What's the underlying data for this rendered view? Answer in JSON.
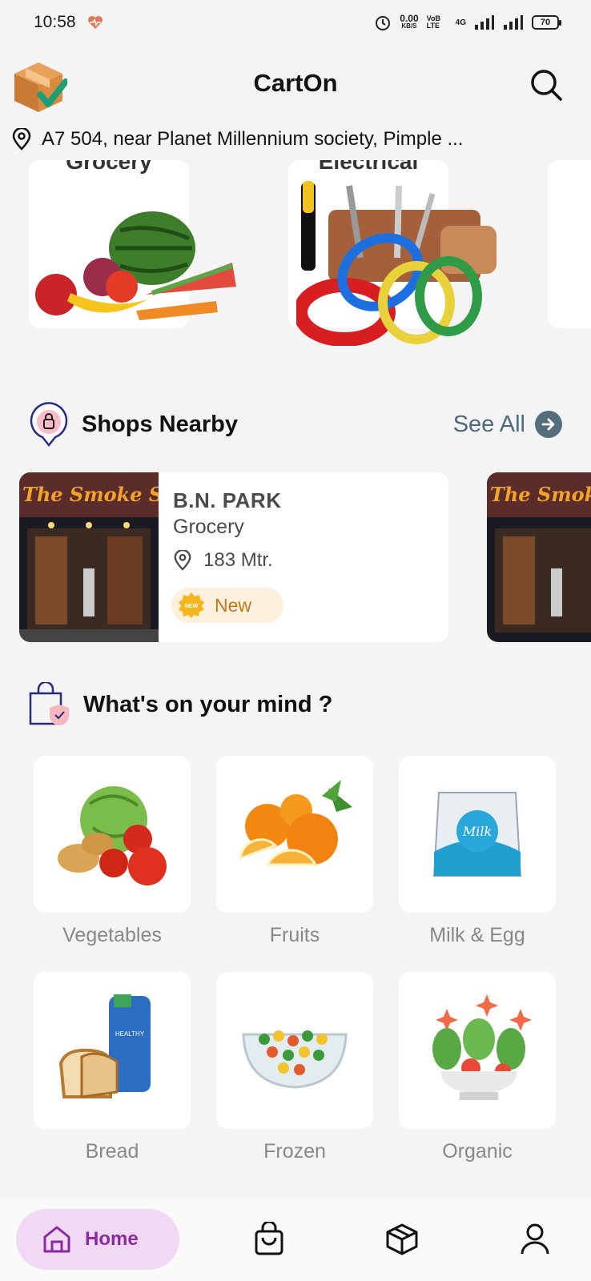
{
  "status_bar": {
    "time": "10:58",
    "net_speed_value": "0.00",
    "net_speed_unit": "KB/S",
    "volte": "VoB LTE",
    "network": "4G",
    "battery": "70"
  },
  "header": {
    "app_name": "CartOn",
    "address": "A7 504, near Planet Millennium society, Pimple ..."
  },
  "categories_carousel": [
    {
      "label": "Grocery",
      "icon": "grocery-image"
    },
    {
      "label": "Electrical",
      "icon": "electrical-image"
    }
  ],
  "shops_nearby": {
    "title": "Shops Nearby",
    "see_all": "See All",
    "shops": [
      {
        "name": "B.N. PARK",
        "category": "Grocery",
        "distance": "183 Mtr.",
        "badge_icon_text": "NEW",
        "badge": "New",
        "image_text": "The Smoke Shop"
      }
    ]
  },
  "whats_on_mind": {
    "title": "What's on your mind ?",
    "tiles": [
      {
        "label": "Vegetables",
        "icon": "vegetables-image"
      },
      {
        "label": "Fruits",
        "icon": "fruits-image"
      },
      {
        "label": "Milk & Egg",
        "icon": "milk-image",
        "art_text": "Milk"
      },
      {
        "label": "Bread",
        "icon": "bread-image",
        "art_text": "HEALTHY"
      },
      {
        "label": "Frozen",
        "icon": "frozen-image"
      },
      {
        "label": "Organic",
        "icon": "organic-image"
      }
    ]
  },
  "bottom_nav": {
    "home": "Home",
    "items": [
      "home-icon",
      "bag-icon",
      "box-icon",
      "profile-icon"
    ]
  },
  "colors": {
    "accent_purple": "#8a2aa0",
    "home_pill": "#f1d8f4",
    "see_all": "#4c6a7e",
    "badge_bg": "#fdf0dd",
    "badge_text": "#c0781c"
  }
}
